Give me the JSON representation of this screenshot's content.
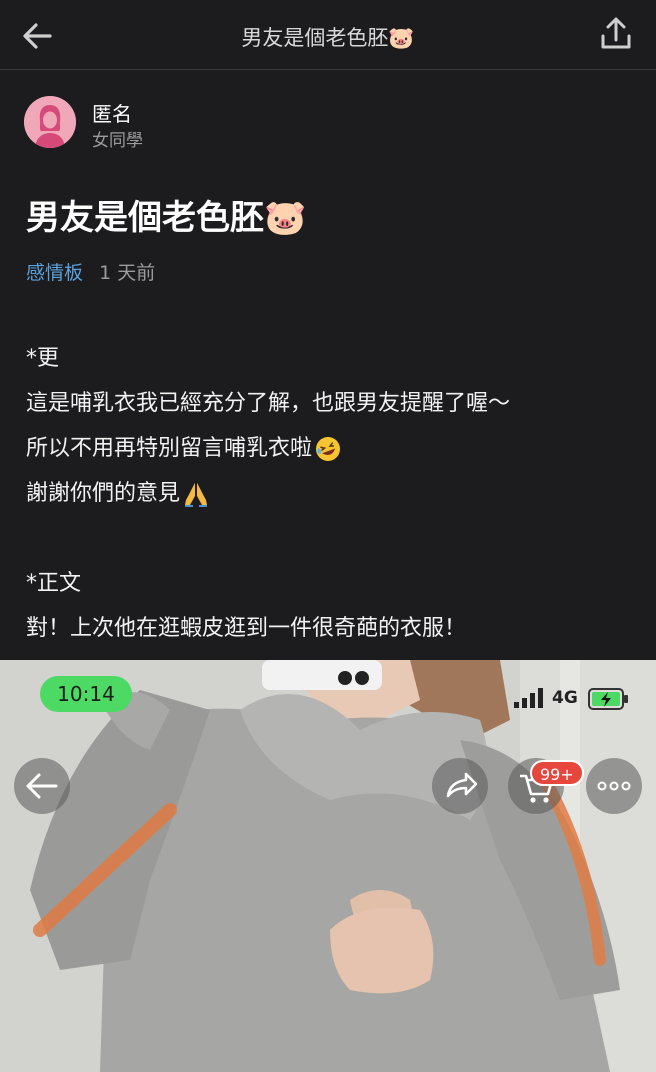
{
  "header": {
    "title": "男友是個老色胚🐷",
    "back_icon": "arrow-left-icon",
    "share_icon": "share-upload-icon"
  },
  "author": {
    "name": "匿名",
    "subtitle": "女同學",
    "avatar_icon": "female-avatar-icon",
    "avatar_color": "#f0a7b8"
  },
  "post": {
    "title": "男友是個老色胚🐷",
    "board": "感情板",
    "time": "1 天前",
    "board_color": "#5aa0db",
    "lines": [
      "*更",
      "這是哺乳衣我已經充分了解，也跟男友提醒了喔～",
      "所以不用再特別留言哺乳衣啦",
      "謝謝你們的意見",
      "",
      "*正文",
      "對！上次他在逛蝦皮逛到一件很奇葩的衣服！"
    ]
  },
  "photo": {
    "status_time": "10:14",
    "network": "4G",
    "cart_badge": "99+",
    "status_time_color": "#4cd964",
    "badge_color": "#e6463c"
  }
}
